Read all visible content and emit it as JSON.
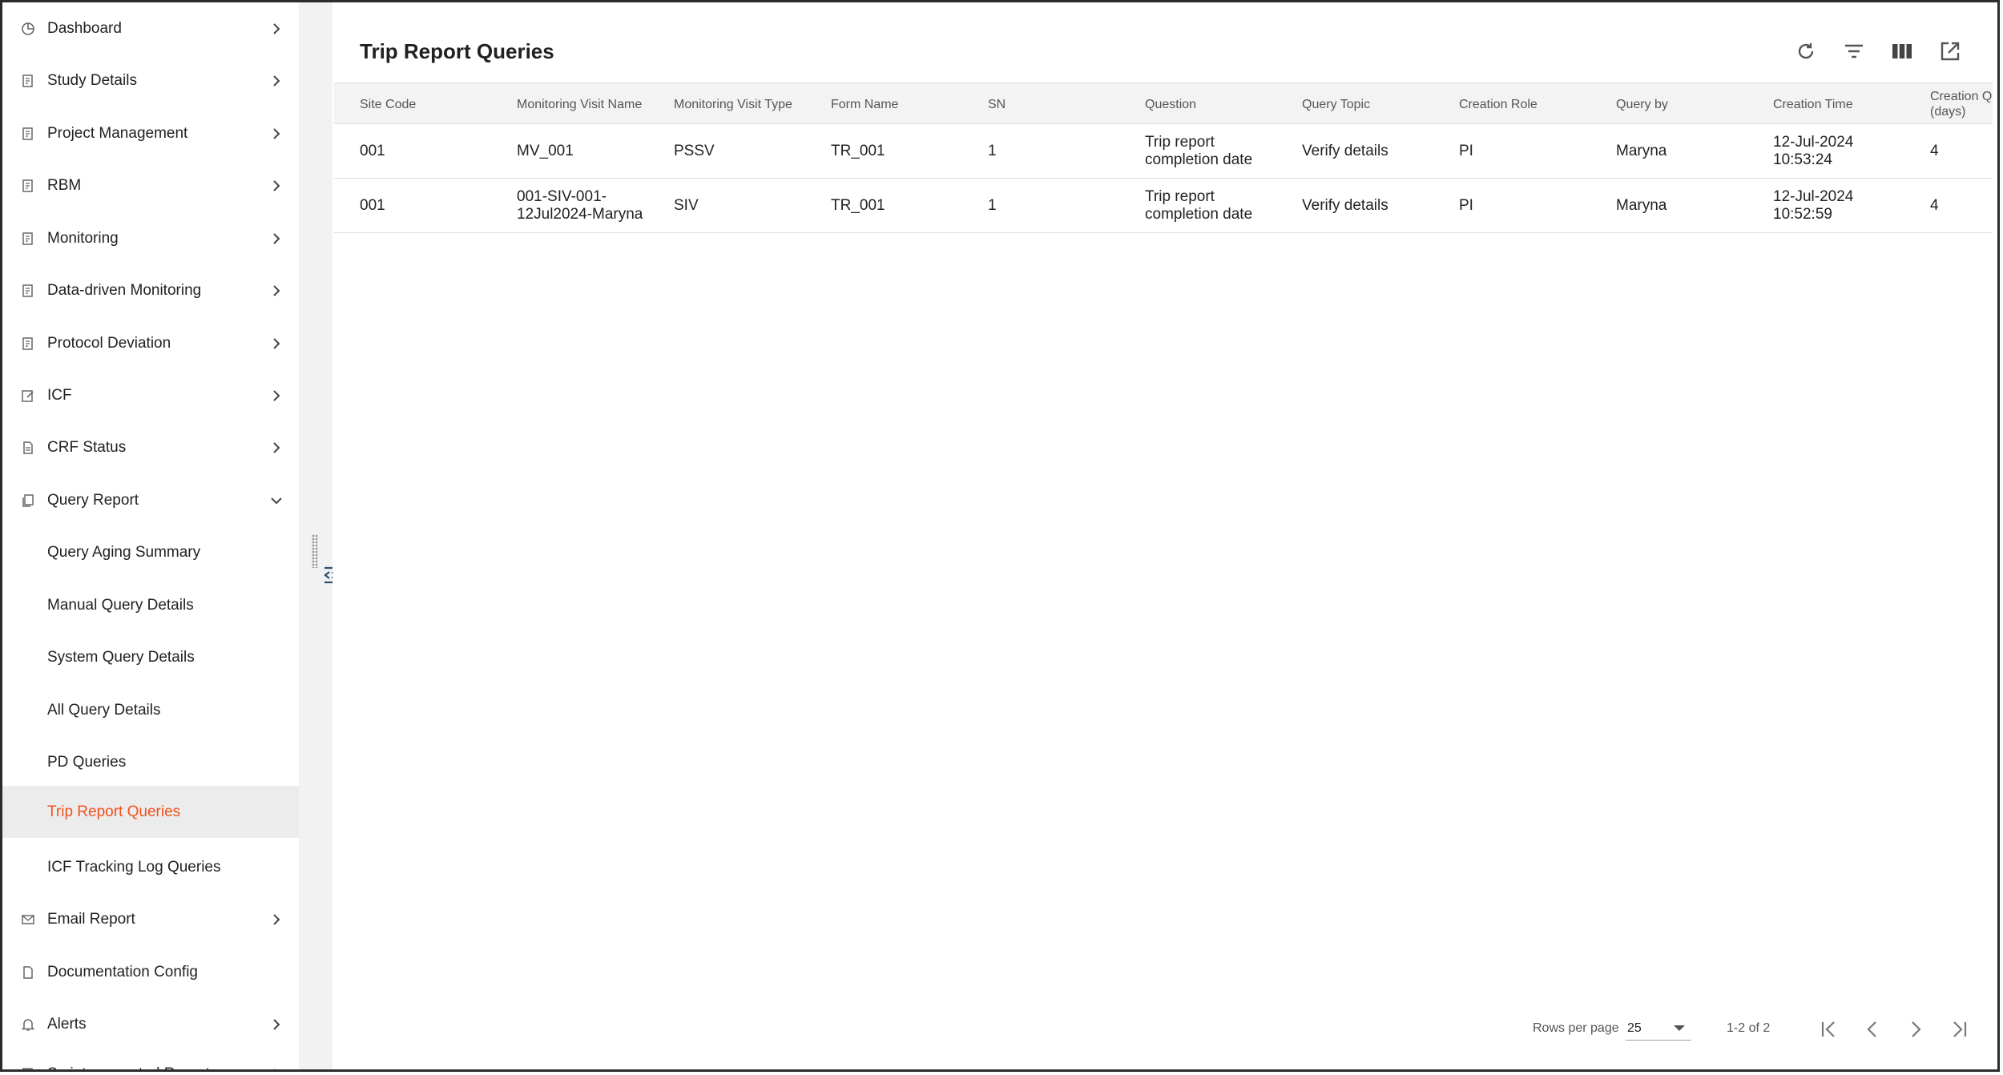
{
  "sidebar": {
    "items": [
      {
        "label": "Dashboard"
      },
      {
        "label": "Study Details"
      },
      {
        "label": "Project Management"
      },
      {
        "label": "RBM"
      },
      {
        "label": "Monitoring"
      },
      {
        "label": "Data-driven Monitoring"
      },
      {
        "label": "Protocol Deviation"
      },
      {
        "label": "ICF"
      },
      {
        "label": "CRF Status"
      },
      {
        "label": "Query Report"
      },
      {
        "label": "Query Aging Summary"
      },
      {
        "label": "Manual Query Details"
      },
      {
        "label": "System Query Details"
      },
      {
        "label": "All Query Details"
      },
      {
        "label": "PD Queries"
      },
      {
        "label": "Trip Report Queries"
      },
      {
        "label": "ICF Tracking Log Queries"
      },
      {
        "label": "Email Report"
      },
      {
        "label": "Documentation Config"
      },
      {
        "label": "Alerts"
      },
      {
        "label": "Script-generated Reports"
      }
    ],
    "active_color": "#f2511b"
  },
  "main": {
    "title": "Trip Report Queries",
    "toolbar_icons": [
      "refresh-icon",
      "filter-icon",
      "columns-icon",
      "open-external-icon"
    ]
  },
  "table": {
    "columns": [
      "Site Code",
      "Monitoring Visit Name",
      "Monitoring Visit Type",
      "Form Name",
      "SN",
      "Question",
      "Query Topic",
      "Creation Role",
      "Query by",
      "Creation Time",
      "Creation Q (days)"
    ],
    "rows": [
      [
        "001",
        "MV_001",
        "PSSV",
        "TR_001",
        "1",
        "Trip report completion date",
        "Verify details",
        "PI",
        "Maryna",
        "12-Jul-2024 10:53:24",
        "4"
      ],
      [
        "001",
        "001-SIV-001-12Jul2024-Maryna",
        "SIV",
        "TR_001",
        "1",
        "Trip report completion date",
        "Verify details",
        "PI",
        "Maryna",
        "12-Jul-2024 10:52:59",
        "4"
      ]
    ]
  },
  "pagination": {
    "rows_per_page_label": "Rows per page",
    "rows_per_page_value": "25",
    "range": "1-2 of 2"
  }
}
